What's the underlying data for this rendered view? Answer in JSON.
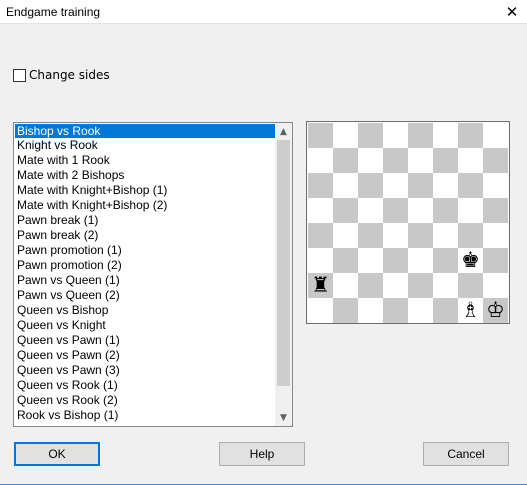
{
  "window": {
    "title": "Endgame training",
    "close_glyph": "✕"
  },
  "options": {
    "change_sides_label": "Change sides",
    "change_sides_checked": false
  },
  "endgames": {
    "selected_index": 0,
    "items": [
      "Bishop vs Rook",
      "Knight vs Rook",
      "Mate with 1 Rook",
      "Mate with 2 Bishops",
      "Mate with Knight+Bishop (1)",
      "Mate with Knight+Bishop (2)",
      "Pawn break (1)",
      "Pawn break (2)",
      "Pawn promotion (1)",
      "Pawn promotion (2)",
      "Pawn vs Queen (1)",
      "Pawn vs Queen (2)",
      "Queen vs Bishop",
      "Queen vs Knight",
      "Queen vs Pawn (1)",
      "Queen vs Pawn (2)",
      "Queen vs Pawn (3)",
      "Queen vs Rook (1)",
      "Queen vs Rook (2)",
      "Rook vs Bishop (1)"
    ]
  },
  "board": {
    "light_color": "#ffffff",
    "dark_color": "#c8c8c8",
    "pieces": [
      {
        "square": "g3",
        "glyph": "♚",
        "name": "black-king-icon"
      },
      {
        "square": "a2",
        "glyph": "♜",
        "name": "black-rook-icon"
      },
      {
        "square": "g1",
        "glyph": "♗",
        "name": "white-bishop-icon"
      },
      {
        "square": "h1",
        "glyph": "♔",
        "name": "white-king-icon"
      }
    ]
  },
  "buttons": {
    "ok": "OK",
    "help": "Help",
    "cancel": "Cancel"
  },
  "colors": {
    "selection": "#0078d7",
    "accent_border": "#0078d7"
  }
}
